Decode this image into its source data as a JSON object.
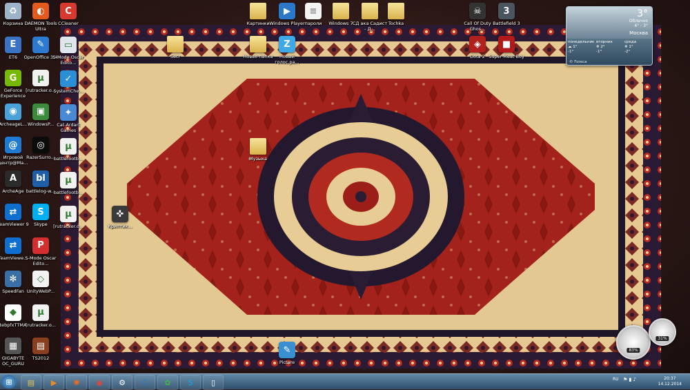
{
  "desktop": {
    "left_column": [
      {
        "label": "Корзина",
        "icon": "recycle-bin-icon",
        "color": "#9fb3c8",
        "glyph": "♻"
      },
      {
        "label": "ET6",
        "icon": "et6-icon",
        "color": "#3b73c4",
        "glyph": "E"
      },
      {
        "label": "GeForce Experience",
        "icon": "geforce-icon",
        "color": "#76b900",
        "glyph": "G"
      },
      {
        "label": "ArcheageL...",
        "icon": "archeage-launcher-icon",
        "color": "#4aa3d8",
        "glyph": "◉"
      },
      {
        "label": "Игровой центр@Ma...",
        "icon": "game-center-icon",
        "color": "#1f7ad1",
        "glyph": "@"
      },
      {
        "label": "ArcheAge",
        "icon": "archeage-icon",
        "color": "#2b2b2b",
        "glyph": "A"
      },
      {
        "label": "TeamViewer 9",
        "icon": "teamviewer-icon",
        "color": "#0e6fd1",
        "glyph": "⇄"
      },
      {
        "label": "TeamViewe...",
        "icon": "teamviewer-icon",
        "color": "#0e6fd1",
        "glyph": "⇄"
      },
      {
        "label": "SpeedFan",
        "icon": "speedfan-icon",
        "color": "#3a6ea5",
        "glyph": "✻"
      },
      {
        "label": "tebpfxTTMA",
        "icon": "shortcut-icon",
        "color": "#ffffff",
        "glyph": "◆"
      },
      {
        "label": "GIGABYTE OC_GURU",
        "icon": "gigabyte-icon",
        "color": "#555555",
        "glyph": "▦"
      }
    ],
    "second_column": [
      {
        "label": "DAEMON Tools Ultra",
        "icon": "daemon-tools-icon",
        "color": "#e25a1c",
        "glyph": "◐"
      },
      {
        "label": "OpenOffice 3.4",
        "icon": "openoffice-icon",
        "color": "#2d7bd1",
        "glyph": "✎"
      },
      {
        "label": "[rutracker.o...",
        "icon": "utorrent-icon",
        "color": "#f1f1f1",
        "glyph": "µ"
      },
      {
        "label": "WindowsP...",
        "icon": "windows-program-icon",
        "color": "#3c8b3c",
        "glyph": "▣"
      },
      {
        "label": "RazerSurro...",
        "icon": "razer-icon",
        "color": "#0b0b0b",
        "glyph": "◎"
      },
      {
        "label": "battlelog-w...",
        "icon": "battlelog-icon",
        "color": "#1f5fa8",
        "glyph": "bl"
      },
      {
        "label": "Skype",
        "icon": "skype-icon",
        "color": "#00aff0",
        "glyph": "S"
      },
      {
        "label": "S-Mode Oscar Edito...",
        "icon": "pdf-icon",
        "color": "#d32f2f",
        "glyph": "P"
      },
      {
        "label": "UnityWebP...",
        "icon": "unity-icon",
        "color": "#f2f2f2",
        "glyph": "◇"
      },
      {
        "label": "[rutracker.o...",
        "icon": "utorrent-icon",
        "color": "#f1f1f1",
        "glyph": "µ"
      },
      {
        "label": "TS2012",
        "icon": "ts2012-icon",
        "color": "#8a3f1e",
        "glyph": "▤"
      }
    ],
    "third_column": [
      {
        "label": "CCleaner",
        "icon": "ccleaner-icon",
        "color": "#d63a2f",
        "glyph": "C"
      },
      {
        "label": "S-Mode Oscar Edito...",
        "icon": "app-icon",
        "color": "#dfe6ee",
        "glyph": "▭"
      },
      {
        "label": "SystemChe...",
        "icon": "systemcheck-icon",
        "color": "#2a8fd6",
        "glyph": "✓"
      },
      {
        "label": "Cat-Ardart Games",
        "icon": "cat-ardart-icon",
        "color": "#4a8ad4",
        "glyph": "✦"
      },
      {
        "label": "battlefootb...",
        "icon": "utorrent-icon",
        "color": "#f1f1f1",
        "glyph": "µ"
      },
      {
        "label": "battlefootb...",
        "icon": "utorrent-icon",
        "color": "#f1f1f1",
        "glyph": "µ"
      },
      {
        "label": "[rutracker.o...",
        "icon": "utorrent-icon",
        "color": "#f1f1f1",
        "glyph": "µ"
      }
    ],
    "top_row": [
      {
        "label": "Картинки",
        "icon": "folder-icon",
        "kind": "folder"
      },
      {
        "label": "Windows Player",
        "icon": "windows-player-icon",
        "kind": "app",
        "color": "#2b78c8",
        "glyph": "▶"
      },
      {
        "label": "пароли",
        "icon": "text-file-icon",
        "kind": "page"
      },
      {
        "label": "Windows 7",
        "icon": "folder-icon",
        "kind": "folder"
      },
      {
        "label": "СД ака Садист - Д...",
        "icon": "folder-icon",
        "kind": "folder"
      },
      {
        "label": "Tochka",
        "icon": "folder-icon",
        "kind": "folder"
      },
      {
        "label": "Call Of Duty Ghos...",
        "icon": "cod-ghosts-icon",
        "kind": "app",
        "color": "#333333",
        "glyph": "☠"
      },
      {
        "label": "Battlefield 3",
        "icon": "battlefield-icon",
        "kind": "app",
        "color": "#4a5560",
        "glyph": "3"
      }
    ],
    "middle_row": [
      {
        "label": "Secr",
        "icon": "folder-icon",
        "kind": "folder"
      },
      {
        "label": "Новая папка",
        "icon": "folder-icon",
        "kind": "folder"
      },
      {
        "label": "Новый голос.pa...",
        "icon": "teamspeak-icon",
        "kind": "app",
        "color": "#3fa9e8",
        "glyph": "Z"
      },
      {
        "label": "Dota 2",
        "icon": "dota2-icon",
        "kind": "app",
        "color": "#b0211d",
        "glyph": "◈"
      },
      {
        "label": "Super Meat Boy",
        "icon": "super-meat-boy-icon",
        "kind": "app",
        "color": "#b11a1a",
        "glyph": "■"
      }
    ],
    "misc": [
      {
        "label": "Музыка",
        "icon": "folder-icon",
        "kind": "folder"
      },
      {
        "label": "Криптик...",
        "icon": "kryptic-icon",
        "kind": "app",
        "color": "#3a3a3a",
        "glyph": "✜"
      },
      {
        "label": "Picture",
        "icon": "picture-icon",
        "kind": "app",
        "color": "#3a8fd1",
        "glyph": "✎"
      }
    ]
  },
  "weather": {
    "temperature": "3°",
    "condition": "Облачно",
    "range": "4° - 3°",
    "city": "Москва",
    "days": [
      {
        "name": "понедельник",
        "hi": "1°",
        "lo": "-1°"
      },
      {
        "name": "вторник",
        "hi": "2°",
        "lo": "-1°"
      },
      {
        "name": "среда",
        "hi": "1°",
        "lo": "-2°"
      }
    ],
    "credit": "© Foreca"
  },
  "gauges": {
    "cpu": "83%",
    "memory": "31%"
  },
  "taskbar": {
    "items": [
      {
        "name": "explorer-icon",
        "glyph": "▤",
        "color": "#e8c559"
      },
      {
        "name": "media-player-icon",
        "glyph": "▶",
        "color": "#f08a24"
      },
      {
        "name": "app-orange-icon",
        "glyph": "✺",
        "color": "#f26b1d"
      },
      {
        "name": "chrome-icon",
        "glyph": "◉",
        "color": "#e7423a"
      },
      {
        "name": "steam-icon",
        "glyph": "⚙",
        "color": "#1b2838"
      },
      {
        "name": "cat-app-icon",
        "glyph": "C",
        "color": "#2d78c8"
      },
      {
        "name": "icq-icon",
        "glyph": "✿",
        "color": "#42b649"
      },
      {
        "name": "skype-icon",
        "glyph": "S",
        "color": "#00aff0"
      },
      {
        "name": "phone-app-icon",
        "glyph": "▯",
        "color": "#2a2a2a"
      }
    ],
    "language": "RU",
    "time": "20:37",
    "date": "14.12.2014"
  }
}
